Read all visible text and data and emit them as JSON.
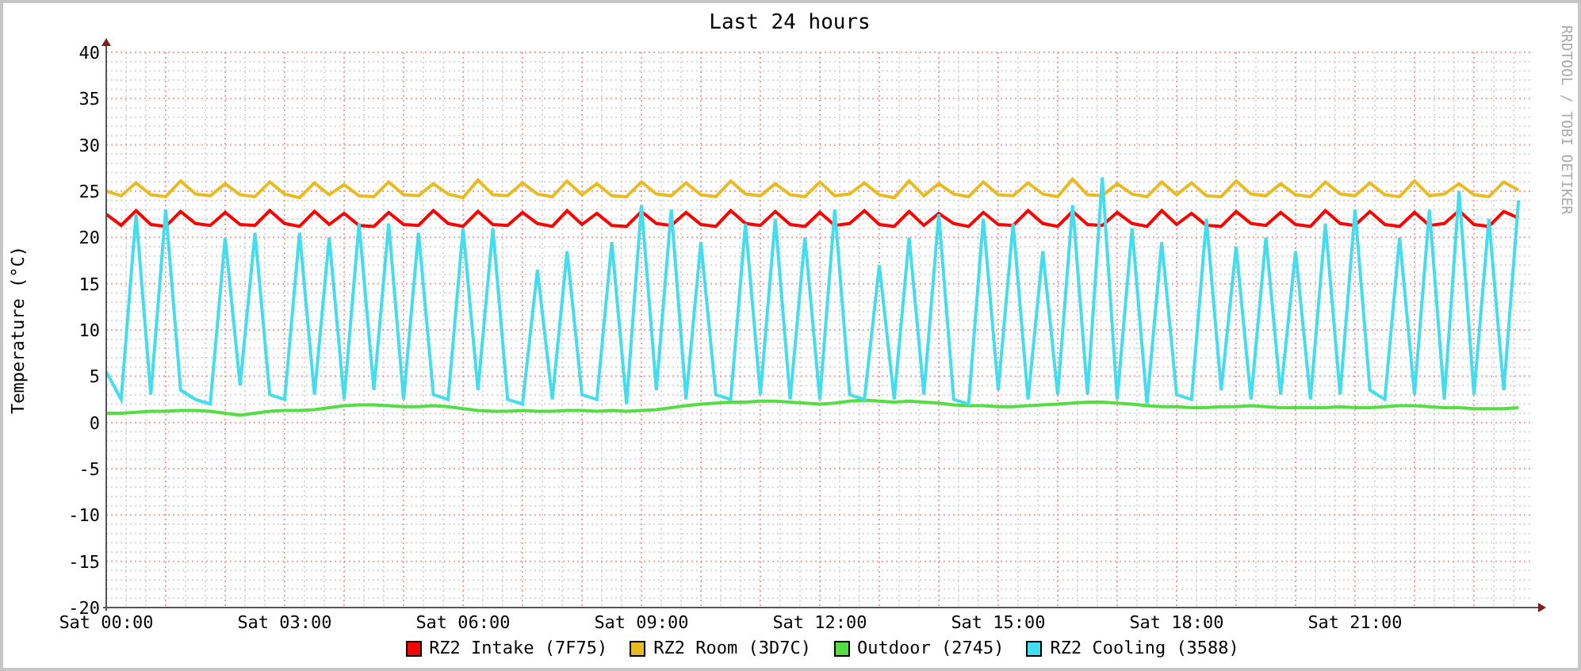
{
  "credit": "RRDTOOL / TOBI OETIKER",
  "chart_data": {
    "type": "line",
    "grid": true,
    "title": "Last 24 hours",
    "ylabel": "Temperature (°C)",
    "ylim": [
      -20,
      40
    ],
    "yticks": [
      -20,
      -15,
      -10,
      -5,
      0,
      5,
      10,
      15,
      20,
      25,
      30,
      35,
      40
    ],
    "categories": [
      "Sat 00:00",
      null,
      null,
      null,
      null,
      null,
      null,
      null,
      null,
      null,
      null,
      null,
      "Sat 03:00",
      null,
      null,
      null,
      null,
      null,
      null,
      null,
      null,
      null,
      null,
      null,
      "Sat 06:00",
      null,
      null,
      null,
      null,
      null,
      null,
      null,
      null,
      null,
      null,
      null,
      "Sat 09:00",
      null,
      null,
      null,
      null,
      null,
      null,
      null,
      null,
      null,
      null,
      null,
      "Sat 12:00",
      null,
      null,
      null,
      null,
      null,
      null,
      null,
      null,
      null,
      null,
      null,
      "Sat 15:00",
      null,
      null,
      null,
      null,
      null,
      null,
      null,
      null,
      null,
      null,
      null,
      "Sat 18:00",
      null,
      null,
      null,
      null,
      null,
      null,
      null,
      null,
      null,
      null,
      null,
      "Sat 21:00",
      null,
      null,
      null,
      null,
      null,
      null,
      null,
      null,
      null,
      null,
      null
    ],
    "series": [
      {
        "name": "RZ2 Intake (7F75)",
        "color": "#ff0000",
        "values": [
          22.5,
          21.3,
          22.9,
          21.4,
          21.2,
          22.8,
          21.5,
          21.3,
          22.7,
          21.4,
          21.3,
          22.9,
          21.5,
          21.2,
          22.8,
          21.4,
          22.6,
          21.3,
          21.2,
          22.7,
          21.4,
          21.3,
          22.9,
          21.5,
          21.2,
          22.8,
          21.4,
          21.3,
          22.7,
          21.5,
          21.2,
          22.9,
          21.4,
          22.6,
          21.3,
          21.2,
          22.8,
          21.5,
          21.3,
          22.7,
          21.4,
          21.2,
          22.9,
          21.5,
          21.3,
          22.8,
          21.4,
          21.2,
          22.7,
          21.3,
          21.5,
          22.9,
          21.4,
          21.2,
          22.8,
          21.3,
          22.6,
          21.5,
          21.2,
          22.7,
          21.4,
          21.3,
          22.9,
          21.5,
          21.2,
          22.8,
          21.4,
          21.3,
          22.7,
          21.5,
          21.2,
          22.9,
          21.4,
          22.6,
          21.3,
          21.2,
          22.8,
          21.5,
          21.3,
          22.7,
          21.4,
          21.2,
          22.9,
          21.5,
          21.3,
          22.8,
          21.4,
          21.2,
          22.7,
          21.3,
          21.5,
          22.9,
          21.4,
          21.2,
          22.8,
          22.1
        ]
      },
      {
        "name": "RZ2 Room (3D7C)",
        "color": "#e8bb20",
        "values": [
          25.0,
          24.5,
          25.9,
          24.6,
          24.4,
          26.1,
          24.7,
          24.5,
          25.8,
          24.6,
          24.4,
          26.0,
          24.7,
          24.3,
          25.9,
          24.6,
          25.7,
          24.5,
          24.4,
          26.0,
          24.6,
          24.5,
          25.8,
          24.7,
          24.3,
          26.2,
          24.6,
          24.5,
          25.9,
          24.7,
          24.4,
          26.1,
          24.6,
          25.8,
          24.5,
          24.4,
          26.0,
          24.7,
          24.5,
          25.9,
          24.6,
          24.4,
          26.1,
          24.7,
          24.5,
          25.8,
          24.6,
          24.4,
          26.0,
          24.5,
          24.7,
          25.9,
          24.6,
          24.3,
          26.1,
          24.5,
          25.8,
          24.7,
          24.4,
          26.0,
          24.6,
          24.5,
          25.9,
          24.7,
          24.4,
          26.3,
          24.6,
          24.5,
          25.8,
          24.7,
          24.4,
          26.0,
          24.6,
          25.9,
          24.5,
          24.4,
          26.1,
          24.7,
          24.5,
          25.8,
          24.6,
          24.4,
          26.0,
          24.7,
          24.5,
          25.9,
          24.6,
          24.4,
          26.1,
          24.5,
          24.7,
          25.8,
          24.6,
          24.4,
          26.0,
          25.1
        ]
      },
      {
        "name": "Outdoor (2745)",
        "color": "#55dd44",
        "values": [
          1.0,
          1.0,
          1.1,
          1.2,
          1.2,
          1.3,
          1.3,
          1.2,
          1.0,
          0.8,
          1.0,
          1.2,
          1.3,
          1.3,
          1.4,
          1.6,
          1.8,
          1.9,
          1.9,
          1.8,
          1.7,
          1.7,
          1.8,
          1.7,
          1.5,
          1.3,
          1.2,
          1.2,
          1.3,
          1.2,
          1.2,
          1.3,
          1.3,
          1.2,
          1.3,
          1.2,
          1.3,
          1.4,
          1.6,
          1.8,
          2.0,
          2.1,
          2.2,
          2.2,
          2.3,
          2.3,
          2.2,
          2.1,
          2.0,
          2.1,
          2.3,
          2.4,
          2.3,
          2.2,
          2.3,
          2.2,
          2.1,
          1.9,
          1.8,
          1.8,
          1.7,
          1.7,
          1.8,
          1.9,
          2.0,
          2.1,
          2.2,
          2.2,
          2.1,
          2.0,
          1.8,
          1.7,
          1.7,
          1.6,
          1.6,
          1.7,
          1.7,
          1.8,
          1.7,
          1.6,
          1.6,
          1.6,
          1.6,
          1.7,
          1.6,
          1.6,
          1.7,
          1.8,
          1.8,
          1.7,
          1.6,
          1.6,
          1.5,
          1.5,
          1.5,
          1.6
        ]
      },
      {
        "name": "RZ2 Cooling (3588)",
        "color": "#44ddee",
        "values": [
          5.5,
          2.5,
          22.5,
          3.0,
          23.0,
          3.5,
          2.5,
          2.0,
          20.0,
          4.0,
          20.5,
          3.0,
          2.5,
          20.5,
          3.0,
          20.0,
          2.5,
          21.5,
          3.5,
          21.5,
          2.5,
          20.5,
          3.0,
          2.5,
          21.0,
          3.5,
          21.0,
          2.5,
          2.0,
          16.5,
          2.5,
          18.5,
          3.0,
          2.5,
          19.5,
          2.0,
          23.5,
          3.5,
          23.0,
          2.5,
          19.5,
          3.0,
          2.5,
          21.5,
          3.0,
          22.0,
          2.5,
          20.0,
          2.5,
          23.0,
          3.0,
          2.5,
          17.0,
          2.5,
          20.0,
          3.0,
          22.5,
          2.5,
          2.0,
          22.0,
          3.5,
          21.5,
          2.5,
          18.5,
          3.0,
          23.5,
          3.0,
          26.5,
          2.5,
          21.0,
          2.0,
          19.5,
          3.0,
          2.5,
          22.0,
          3.5,
          19.0,
          2.5,
          20.0,
          3.0,
          18.5,
          2.5,
          21.5,
          3.0,
          23.0,
          3.5,
          2.5,
          20.0,
          3.0,
          23.0,
          2.5,
          25.0,
          3.0,
          22.0,
          3.5,
          24.0
        ]
      }
    ]
  }
}
